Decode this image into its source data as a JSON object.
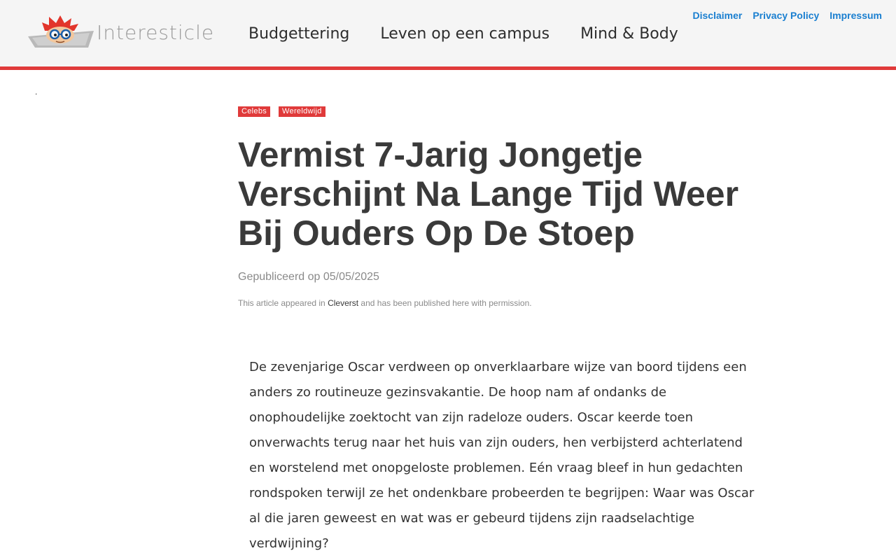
{
  "header": {
    "logo": {
      "text": "Interesticle",
      "icon": "cartoon-face-logo"
    },
    "main_nav": [
      {
        "label": "Budgettering"
      },
      {
        "label": "Leven op een campus"
      },
      {
        "label": "Mind & Body"
      }
    ],
    "util_nav": [
      {
        "label": "Disclaimer"
      },
      {
        "label": "Privacy Policy"
      },
      {
        "label": "Impressum"
      }
    ]
  },
  "stray_mark": ".",
  "article": {
    "tags": [
      {
        "label": "Celebs"
      },
      {
        "label": "Wereldwijd"
      }
    ],
    "title": "Vermist 7-Jarig Jongetje Verschijnt Na Lange Tijd Weer Bij Ouders Op De Stoep",
    "published": "Gepubliceerd op 05/05/2025",
    "attribution": {
      "prefix": "This article appeared in ",
      "source": "Cleverst",
      "suffix": " and has been published here with permission."
    },
    "paragraph": "De zevenjarige Oscar verdween op onverklaarbare wijze van boord tijdens een anders zo routineuze gezinsvakantie. De hoop nam af ondanks de onophoudelijke zoektocht van zijn radeloze ouders. Oscar keerde toen onverwachts terug naar het huis van zijn ouders, hen verbijsterd achterlatend en worstelend met onopgeloste problemen. Eén vraag bleef in hun gedachten rondspoken terwijl ze het ondenkbare probeerden te begrijpen: Waar was Oscar al die jaren geweest en wat was er gebeurd tijdens zijn raadselachtige verdwijning?"
  },
  "colors": {
    "accent": "#e03a3a",
    "link": "#1a7fd0",
    "header_bg": "#f5f5f5",
    "title": "#3a3a3a"
  }
}
